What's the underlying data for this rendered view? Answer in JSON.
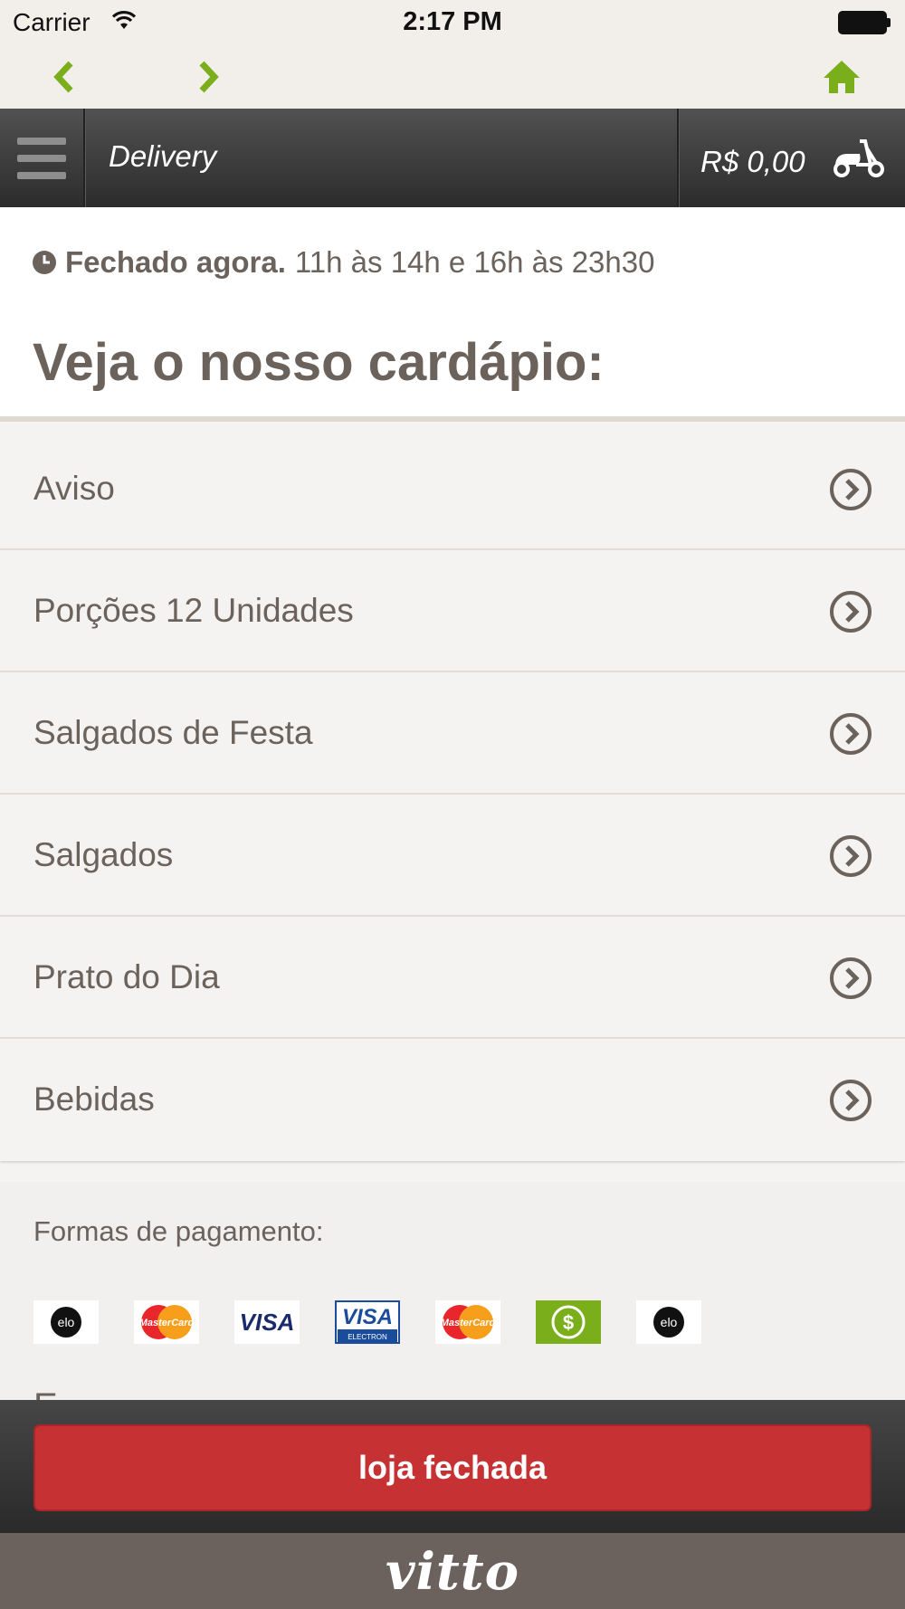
{
  "status_bar": {
    "carrier": "Carrier",
    "time": "2:17 PM",
    "icons": [
      "wifi-icon",
      "battery-icon"
    ]
  },
  "browser_nav": {
    "back_icon": "chevron-left-icon",
    "forward_icon": "chevron-right-icon",
    "home_icon": "home-icon",
    "accent_color": "#7aae1a"
  },
  "header": {
    "menu_icon": "hamburger-menu-icon",
    "title": "Delivery",
    "cart_total": "R$ 0,00",
    "cart_icon": "scooter-icon"
  },
  "info": {
    "closed_label": "Fechado agora.",
    "hours": "11h às 14h e 16h às 23h30",
    "heading": "Veja o nosso cardápio:"
  },
  "menu": {
    "items": [
      {
        "label": "Aviso"
      },
      {
        "label": "Porções 12 Unidades"
      },
      {
        "label": "Salgados de Festa"
      },
      {
        "label": "Salgados"
      },
      {
        "label": "Prato do Dia"
      },
      {
        "label": "Bebidas"
      }
    ],
    "item_icon": "chevron-circle-right-icon"
  },
  "payments": {
    "label": "Formas de pagamento:",
    "methods": [
      {
        "name": "elo",
        "text": "elo"
      },
      {
        "name": "mastercard",
        "text": "MasterCard"
      },
      {
        "name": "visa",
        "text": "VISA"
      },
      {
        "name": "visa-electron",
        "text": "VISA",
        "subtext": "ELECTRON"
      },
      {
        "name": "mastercard",
        "text": "MasterCard"
      },
      {
        "name": "cash",
        "text": "$"
      },
      {
        "name": "elo",
        "text": "elo"
      }
    ],
    "partial_text": "E"
  },
  "footer": {
    "button_label": "loja fechada",
    "button_color": "#c63233"
  },
  "brand": {
    "logo_text": "vitto"
  }
}
